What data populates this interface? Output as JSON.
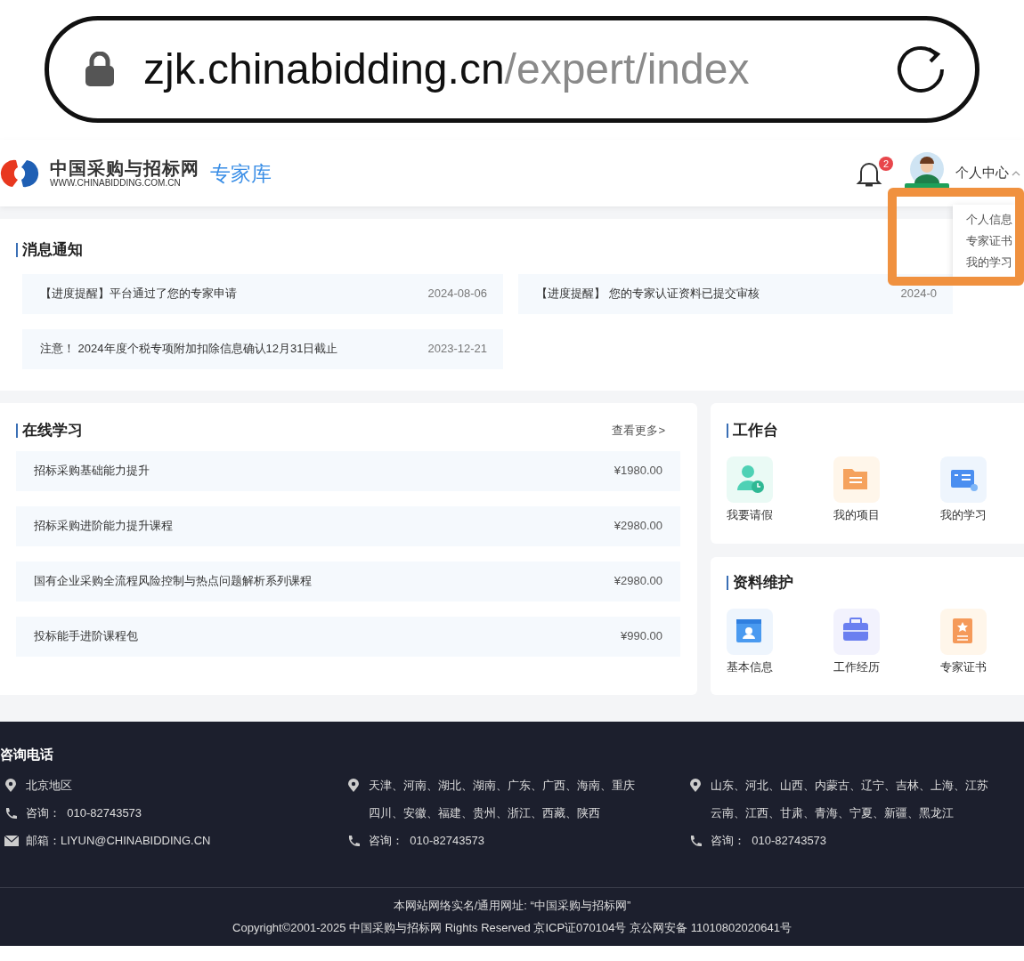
{
  "address_bar": {
    "host": "zjk.chinabidding.cn",
    "path": "/expert/index"
  },
  "header": {
    "logo_title": "中国采购与招标网",
    "logo_subtitle": "WWW.CHINABIDDING.COM.CN",
    "product": "专家库",
    "notification_count": "2",
    "user_menu": "个人中心",
    "expanded": true
  },
  "user_dropdown": [
    "个人信息",
    "专家证书",
    "我的学习"
  ],
  "notices": {
    "title": "消息通知",
    "items": [
      {
        "text": "【进度提醒】平台通过了您的专家申请",
        "date": "2024-08-06"
      },
      {
        "text": "【进度提醒】 您的专家认证资料已提交审核",
        "date": "2024-0"
      },
      {
        "text": "注意！ 2024年度个税专项附加扣除信息确认12月31日截止",
        "date": "2023-12-21"
      }
    ]
  },
  "online_learning": {
    "title": "在线学习",
    "more": "查看更多>",
    "courses": [
      {
        "name": "招标采购基础能力提升",
        "price": "¥1980.00"
      },
      {
        "name": "招标采购进阶能力提升课程",
        "price": "¥2980.00"
      },
      {
        "name": "国有企业采购全流程风险控制与热点问题解析系列课程",
        "price": "¥2980.00"
      },
      {
        "name": "投标能手进阶课程包",
        "price": "¥990.00"
      }
    ]
  },
  "workbench": {
    "title": "工作台",
    "items": [
      {
        "label": "我要请假",
        "kind": "leave"
      },
      {
        "label": "我的项目",
        "kind": "folder"
      },
      {
        "label": "我的学习",
        "kind": "study"
      }
    ]
  },
  "profile_maintenance": {
    "title": "资料维护",
    "items": [
      {
        "label": "基本信息",
        "kind": "profile"
      },
      {
        "label": "工作经历",
        "kind": "briefcase"
      },
      {
        "label": "专家证书",
        "kind": "certificate"
      }
    ]
  },
  "footer": {
    "title": "咨询电话",
    "columns": [
      [
        {
          "kind": "location",
          "lines": [
            "北京地区"
          ]
        },
        {
          "kind": "phone",
          "lines": [
            "咨询：  010-82743573"
          ]
        },
        {
          "kind": "mail",
          "lines": [
            "邮箱：LIYUN@CHINABIDDING.CN"
          ]
        }
      ],
      [
        {
          "kind": "location",
          "lines": [
            "天津、河南、湖北、湖南、广东、广西、海南、重庆",
            "四川、安徽、福建、贵州、浙江、西藏、陕西"
          ]
        },
        {
          "kind": "phone",
          "lines": [
            "咨询：  010-82743573"
          ]
        }
      ],
      [
        {
          "kind": "location",
          "lines": [
            "山东、河北、山西、内蒙古、辽宁、吉林、上海、江苏",
            "云南、江西、甘肃、青海、宁夏、新疆、黑龙江"
          ]
        },
        {
          "kind": "phone",
          "lines": [
            "咨询：  010-82743573"
          ]
        }
      ]
    ],
    "site_name": "本网站网络实名/通用网址: “中国采购与招标网”",
    "copyright": "Copyright©2001-2025 中国采购与招标网 Rights Reserved 京ICP证070104号 京公网安备 11010802020641号"
  },
  "annotation": {
    "kind": "highlight",
    "color": "#f0913f"
  }
}
